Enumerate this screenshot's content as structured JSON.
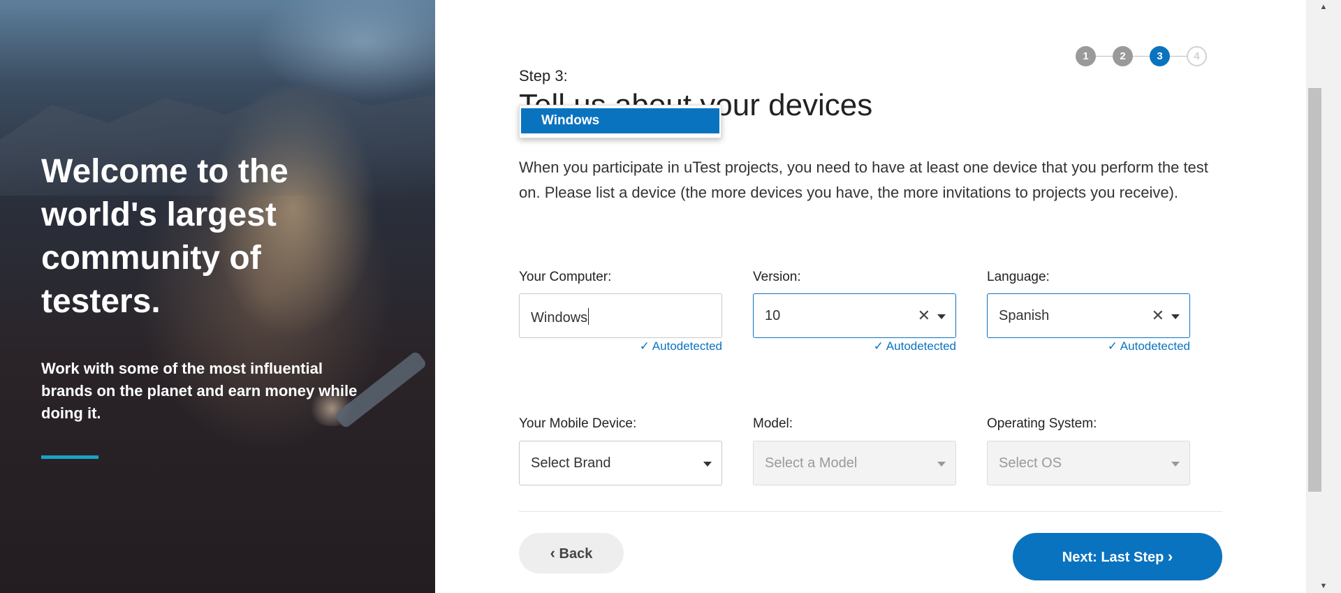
{
  "hero": {
    "title": "Welcome to the world's largest community of testers.",
    "subtitle": "Work with some of the most influential brands on the planet and earn money while doing it.",
    "accent_color": "#1aa2c4"
  },
  "stepper": {
    "steps": [
      {
        "label": "1",
        "state": "done"
      },
      {
        "label": "2",
        "state": "done"
      },
      {
        "label": "3",
        "state": "active"
      },
      {
        "label": "4",
        "state": "todo"
      }
    ]
  },
  "header": {
    "step_label": "Step 3:",
    "title": "Tell us about your devices",
    "intro": "When you participate in uTest projects, you need to have at least one device that you perform the test on. Please list a device (the more devices you have, the more invitations to projects you receive)."
  },
  "autocomplete": {
    "highlighted_option": "Windows"
  },
  "computer": {
    "computer_label": "Your Computer:",
    "computer_value": "Windows",
    "version_label": "Version:",
    "version_value": "10",
    "language_label": "Language:",
    "language_value": "Spanish",
    "autodetected_text": "Autodetected"
  },
  "mobile": {
    "device_label": "Your Mobile Device:",
    "device_placeholder": "Select Brand",
    "model_label": "Model:",
    "model_placeholder": "Select a Model",
    "os_label": "Operating System:",
    "os_placeholder": "Select OS"
  },
  "footer": {
    "back_label": "Back",
    "next_label": "Next: Last Step"
  },
  "icons": {
    "check": "✓",
    "clear": "✕",
    "chevron_left": "‹",
    "chevron_right": "›"
  },
  "colors": {
    "primary": "#0a73c0",
    "completed_step": "#9a9a9a"
  }
}
